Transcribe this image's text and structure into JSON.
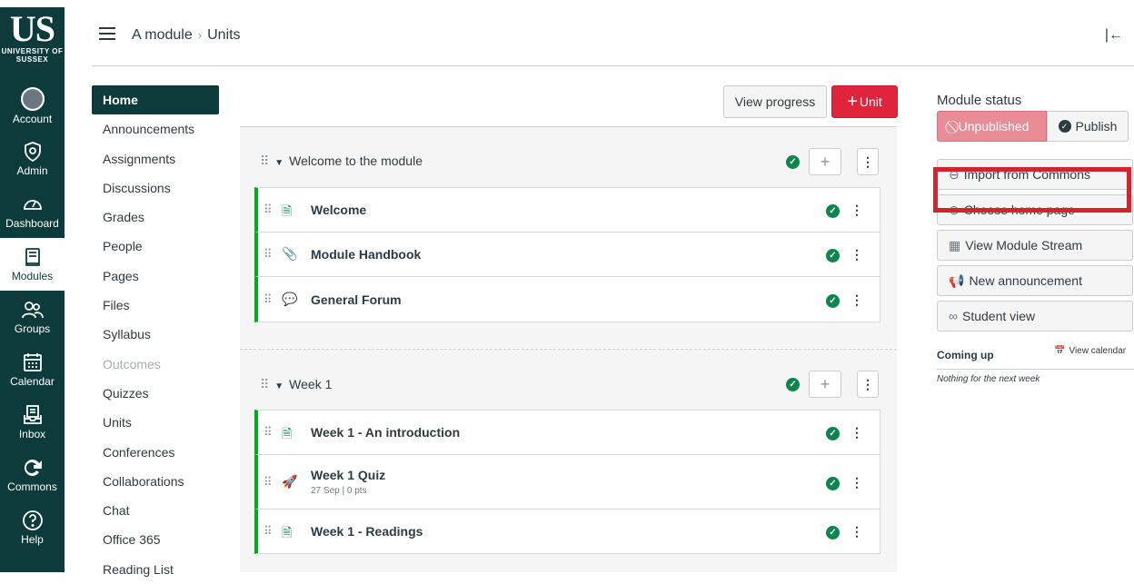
{
  "branding": {
    "logo_text": "US",
    "logo_subtext": "UNIVERSITY OF SUSSEX"
  },
  "global_nav": [
    {
      "label": "Account",
      "icon": "account-avatar-icon"
    },
    {
      "label": "Admin",
      "icon": "admin-shield-icon"
    },
    {
      "label": "Dashboard",
      "icon": "dashboard-gauge-icon"
    },
    {
      "label": "Modules",
      "icon": "modules-book-icon",
      "active": true
    },
    {
      "label": "Groups",
      "icon": "groups-people-icon"
    },
    {
      "label": "Calendar",
      "icon": "calendar-icon"
    },
    {
      "label": "Inbox",
      "icon": "inbox-icon"
    },
    {
      "label": "Commons",
      "icon": "commons-arrow-icon"
    },
    {
      "label": "Help",
      "icon": "help-question-icon"
    }
  ],
  "breadcrumb": {
    "course": "A module",
    "page": "Units",
    "separator": "›"
  },
  "course_nav": [
    {
      "label": "Home",
      "active": true
    },
    {
      "label": "Announcements"
    },
    {
      "label": "Assignments"
    },
    {
      "label": "Discussions"
    },
    {
      "label": "Grades"
    },
    {
      "label": "People"
    },
    {
      "label": "Pages"
    },
    {
      "label": "Files"
    },
    {
      "label": "Syllabus"
    },
    {
      "label": "Outcomes",
      "disabled": true
    },
    {
      "label": "Quizzes"
    },
    {
      "label": "Units"
    },
    {
      "label": "Conferences"
    },
    {
      "label": "Collaborations"
    },
    {
      "label": "Chat"
    },
    {
      "label": "Office 365"
    },
    {
      "label": "Reading List"
    }
  ],
  "toolbar": {
    "view_progress": "View progress",
    "add_unit": "Unit",
    "add_unit_plus": "+"
  },
  "modules": [
    {
      "title": "Welcome to the module",
      "items": [
        {
          "name": "Welcome",
          "icon": "page-icon",
          "meta": ""
        },
        {
          "name": "Module Handbook",
          "icon": "attachment-icon",
          "meta": ""
        },
        {
          "name": "General Forum",
          "icon": "discussion-icon",
          "meta": ""
        }
      ]
    },
    {
      "title": "Week 1",
      "items": [
        {
          "name": "Week 1 - An introduction",
          "icon": "page-icon",
          "meta": ""
        },
        {
          "name": "Week 1 Quiz",
          "icon": "quiz-rocket-icon",
          "meta": "27 Sep  |  0 pts"
        },
        {
          "name": "Week 1 - Readings",
          "icon": "page-icon",
          "meta": ""
        }
      ]
    }
  ],
  "right_panel": {
    "title": "Module status",
    "unpublished": "Unpublished",
    "publish": "Publish",
    "actions": [
      {
        "label": "Import from Commons",
        "icon": "commons-icon"
      },
      {
        "label": "Choose home page",
        "icon": "home-page-icon"
      },
      {
        "label": "View Module Stream",
        "icon": "stream-icon"
      },
      {
        "label": "New announcement",
        "icon": "megaphone-icon"
      },
      {
        "label": "Student view",
        "icon": "glasses-icon"
      }
    ],
    "coming_up": "Coming up",
    "view_calendar": "View calendar",
    "nothing": "Nothing for the next week"
  },
  "colors": {
    "nav_bg": "#0d3b3b",
    "accent_red": "#e0243c",
    "published_green": "#0b874b",
    "highlight_box": "#d3232f"
  }
}
